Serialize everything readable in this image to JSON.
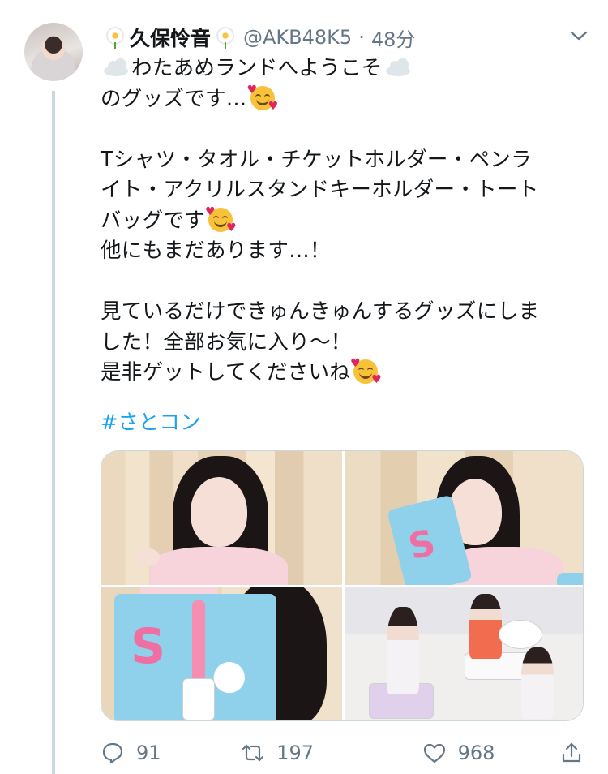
{
  "tweet": {
    "display_name": "久保怜音",
    "handle": "@AKB48K5",
    "separator": "·",
    "time": "48分",
    "lines": [
      "わたあめランドへようこそ",
      "のグッズです…",
      "",
      "Tシャツ・タオル・チケットホルダー・ペンラ",
      "イト・アクリルスタンドキーホルダー・トート",
      "バッグです",
      "他にもまだあります…！",
      "",
      "見ているだけできゅんきゅんするグッズにしま",
      "した！全部お気に入り〜！",
      "是非ゲットしてくださいね"
    ],
    "hashtag": "#さとコン"
  },
  "actions": {
    "reply_count": "91",
    "retweet_count": "197",
    "like_count": "968"
  },
  "icons": {
    "name_decoration": "flower-icon",
    "menu": "chevron-down-icon",
    "reply": "reply-icon",
    "retweet": "retweet-icon",
    "like": "heart-icon",
    "share": "share-icon",
    "emoji_cloud": "cloud-emoji",
    "emoji_smile": "smiling-face-with-hearts-emoji"
  },
  "colors": {
    "link": "#1da1f2",
    "secondary_text": "#657786",
    "thread_line": "#ccd6dd"
  }
}
